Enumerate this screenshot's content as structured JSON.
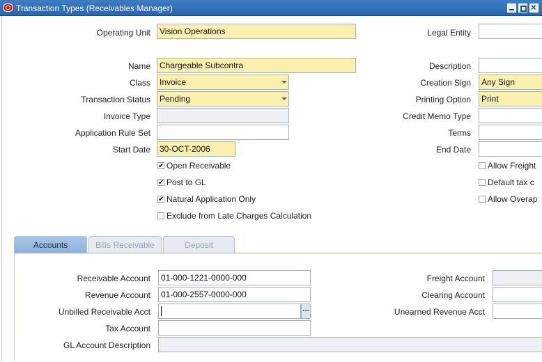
{
  "window": {
    "title": "Transaction Types (Receivables Manager)"
  },
  "header": {
    "operating_unit": {
      "label": "Operating Unit",
      "value": "Vision Operations"
    },
    "legal_entity": {
      "label": "Legal Entity",
      "value": ""
    }
  },
  "form": {
    "name": {
      "label": "Name",
      "value": "Chargeable Subcontra"
    },
    "description": {
      "label": "Description",
      "value": ""
    },
    "class": {
      "label": "Class",
      "value": "Invoice"
    },
    "creation_sign": {
      "label": "Creation Sign",
      "value": "Any Sign"
    },
    "transaction_status": {
      "label": "Transaction Status",
      "value": "Pending"
    },
    "printing_option": {
      "label": "Printing Option",
      "value": "Print"
    },
    "invoice_type": {
      "label": "Invoice Type",
      "value": ""
    },
    "credit_memo_type": {
      "label": "Credit Memo Type",
      "value": ""
    },
    "application_rule_set": {
      "label": "Application Rule Set",
      "value": ""
    },
    "terms": {
      "label": "Terms",
      "value": ""
    },
    "start_date": {
      "label": "Start Date",
      "value": "30-OCT-2006"
    },
    "end_date": {
      "label": "End Date",
      "value": ""
    }
  },
  "checkboxes": {
    "open_receivable": {
      "label": "Open Receivable",
      "checked": true
    },
    "post_to_gl": {
      "label": "Post to GL",
      "checked": true
    },
    "natural_application_only": {
      "label": "Natural Application Only",
      "checked": true
    },
    "exclude_late_charges": {
      "label": "Exclude from Late Charges Calculation",
      "checked": false
    },
    "allow_freight": {
      "label": "Allow Freight",
      "checked": false
    },
    "default_tax": {
      "label": "Default tax c",
      "checked": false
    },
    "allow_overapp": {
      "label": "Allow Overap",
      "checked": false
    }
  },
  "tabs": [
    {
      "label": "Accounts",
      "active": true
    },
    {
      "label": "Bills Receivable",
      "active": false
    },
    {
      "label": "Deposit",
      "active": false
    }
  ],
  "accounts": {
    "receivable_account": {
      "label": "Receivable Account",
      "value": "01-000-1221-0000-000"
    },
    "revenue_account": {
      "label": "Revenue Account",
      "value": "01-000-2557-0000-000"
    },
    "unbilled_receivable_acct": {
      "label": "Unbilled Receivable Acct",
      "value": ""
    },
    "tax_account": {
      "label": "Tax Account",
      "value": ""
    },
    "gl_account_description": {
      "label": "GL Account Description",
      "value": ""
    },
    "freight_account": {
      "label": "Freight Account",
      "value": ""
    },
    "clearing_account": {
      "label": "Clearing Account",
      "value": ""
    },
    "unearned_revenue_acct": {
      "label": "Unearned Revenue Acct",
      "value": ""
    },
    "lov_button_label": "..."
  },
  "colors": {
    "title_bar": "#2a66ab",
    "required_field": "#fcf0b0",
    "readonly_field": "#eef0f3",
    "active_tab": "#8fb3dc"
  }
}
